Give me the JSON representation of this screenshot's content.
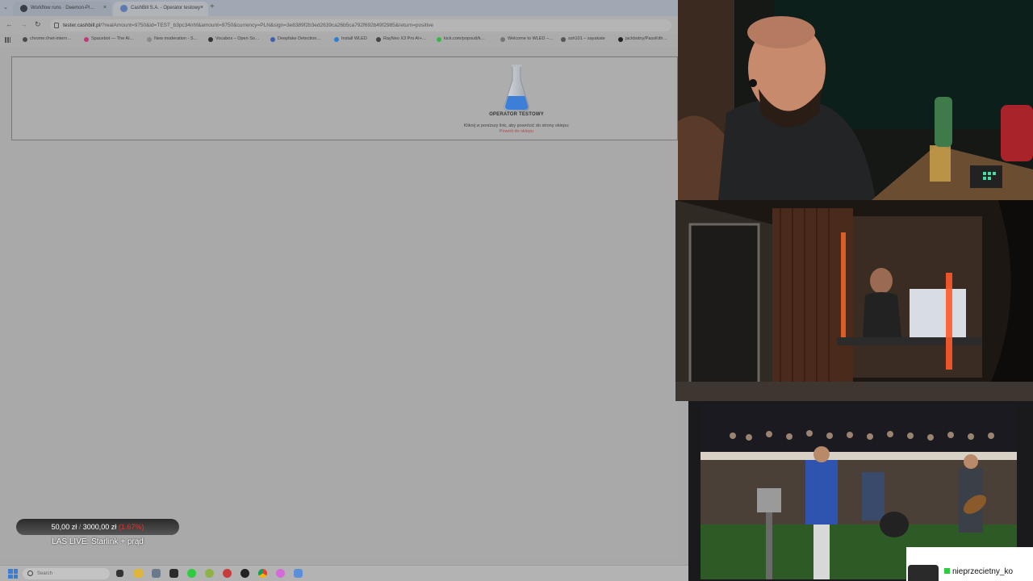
{
  "browser": {
    "tabs": [
      {
        "label": "Workflow runs · Deemon-Pl…",
        "active": false
      },
      {
        "label": "CashBill S.A. - Operator testowy",
        "active": true
      }
    ],
    "new_tab": "+",
    "close_glyph": "×",
    "url": {
      "host": "tester.cashbill.pl",
      "rest": "/?realAmount=9750&id=TEST_b3pc34nhf&amount=9750&currency=PLN&sign=3e8389f2b3ed2639ca26b5ca792f692b49f2985&return=positive"
    },
    "bookmarks": [
      {
        "label": "chrome://net-intern…",
        "color": "#4a4a4a"
      },
      {
        "label": "Spacebot — The AI…",
        "color": "#c0397a"
      },
      {
        "label": "New moderation - S…",
        "color": "#8a8a8a"
      },
      {
        "label": "Vocabox – Open So…",
        "color": "#333333"
      },
      {
        "label": "Deepfake Detection…",
        "color": "#3d5fb0"
      },
      {
        "label": "Install WLED",
        "color": "#2d7fd3"
      },
      {
        "label": "RayNeo X3 Pro AI+…",
        "color": "#444444"
      },
      {
        "label": "kick.com/popoutt/k…",
        "color": "#3bb54a"
      },
      {
        "label": "Welcome to WLED –…",
        "color": "#777777"
      },
      {
        "label": "ssh101 – sayakate",
        "color": "#555555"
      },
      {
        "label": "jackbotny/PassKith…",
        "color": "#222222"
      }
    ]
  },
  "page": {
    "operator_title": "OPERATOR TESTOWY",
    "info": "Kliknij w poniższy link, aby powrócić do strony sklepu:",
    "return_link": "Powrót do sklepu"
  },
  "overlay": {
    "goal": {
      "current": "50,00 zł",
      "separator": "/",
      "target": "3000,00 zł",
      "percent": "(1.67%)"
    },
    "stream_title": "LAS LIVE: Starlink + prąd"
  },
  "taskbar": {
    "search_placeholder": "Search",
    "icons": [
      "file-explorer-icon",
      "taskview-icon",
      "terminal-icon",
      "spotify-icon",
      "xbox-icon",
      "app-icon",
      "obs-icon",
      "chrome-icon",
      "firefox-icon",
      "notepad-icon"
    ]
  },
  "viewer": {
    "name": "nieprzecietny_ko"
  },
  "colors": {
    "accent_red": "#d33333",
    "kick_green": "#2ecc40",
    "flask_blue": "#3d7fd6"
  }
}
